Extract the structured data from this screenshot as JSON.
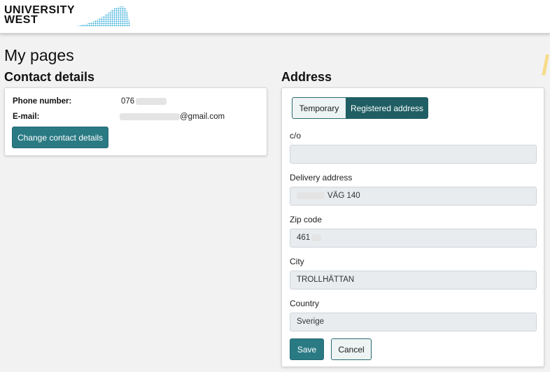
{
  "header": {
    "logo_line1": "UNIVERSITY",
    "logo_line2": "WEST"
  },
  "page": {
    "title": "My pages"
  },
  "contact": {
    "section_title": "Contact details",
    "phone_label": "Phone number:",
    "phone_value": "076",
    "email_label": "E-mail:",
    "email_value": "@gmail.com",
    "change_button": "Change contact details"
  },
  "address": {
    "section_title": "Address",
    "tabs": [
      {
        "label": "Temporary",
        "active": false
      },
      {
        "label": "Registered address",
        "active": true
      }
    ],
    "fields": [
      {
        "label": "c/o",
        "value": ""
      },
      {
        "label": "Delivery address",
        "value": "VÄG 140"
      },
      {
        "label": "Zip code",
        "value": "461"
      },
      {
        "label": "City",
        "value": "TROLLHÄTTAN"
      },
      {
        "label": "Country",
        "value": "Sverige"
      }
    ],
    "save_button": "Save",
    "cancel_button": "Cancel"
  },
  "colors": {
    "brand_teal": "#2a7a84",
    "active_tab": "#1f5e63",
    "accent_yellow": "#f7dc8a",
    "background": "#f2f2f2"
  }
}
